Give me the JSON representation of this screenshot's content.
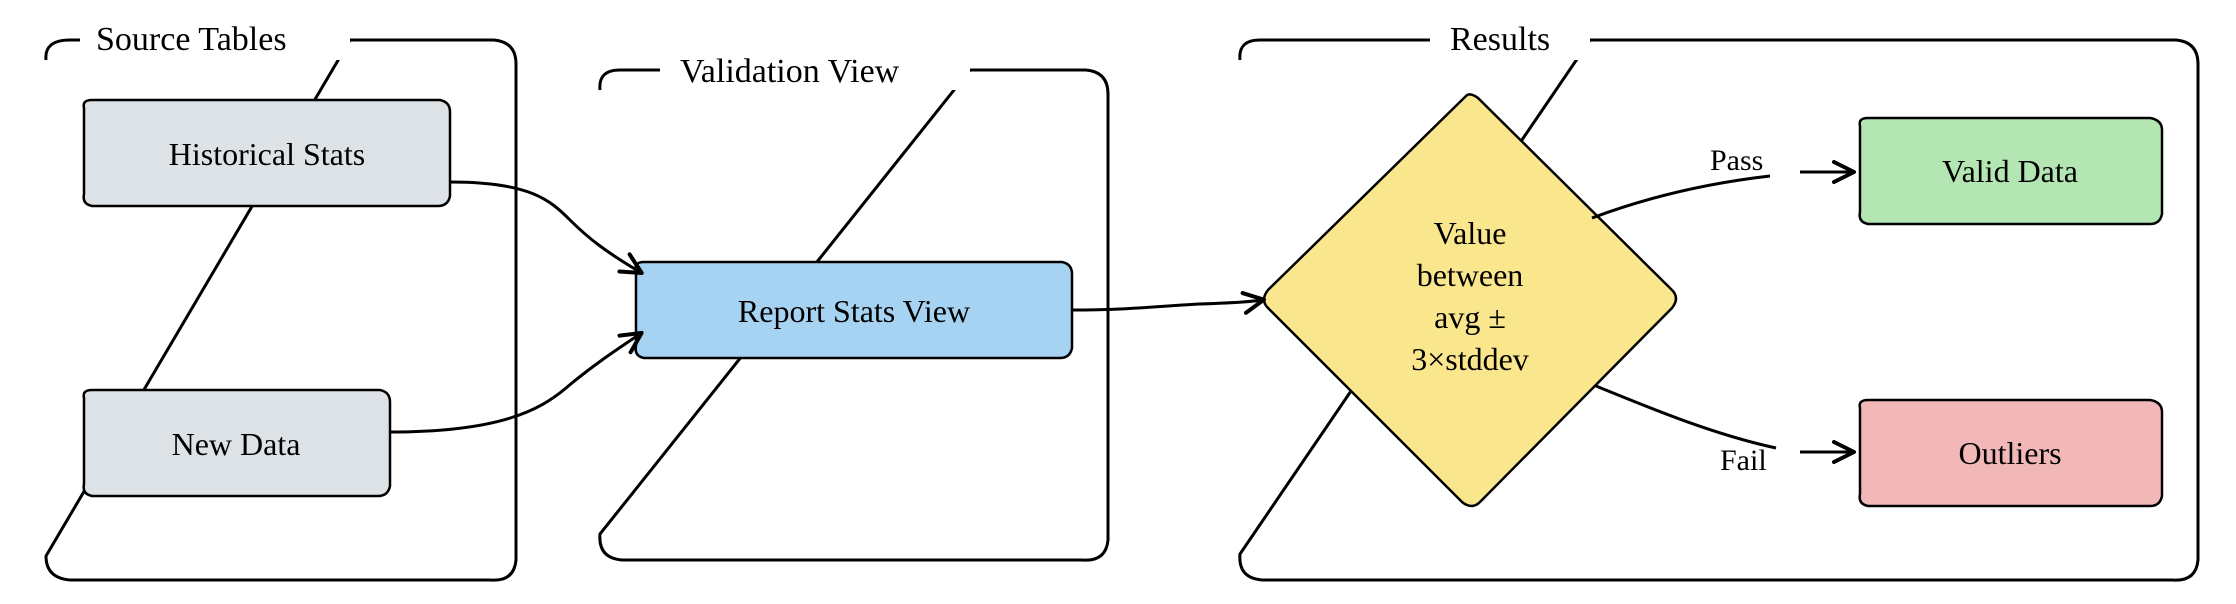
{
  "groups": {
    "source": {
      "label": "Source Tables"
    },
    "validation": {
      "label": "Validation View"
    },
    "results": {
      "label": "Results"
    }
  },
  "nodes": {
    "historical": {
      "label": "Historical Stats"
    },
    "newdata": {
      "label": "New Data"
    },
    "reportstats": {
      "label": "Report Stats View"
    },
    "decision": {
      "line1": "Value",
      "line2": "between",
      "line3": "avg ±",
      "line4": "3×stddev"
    },
    "validdata": {
      "label": "Valid Data"
    },
    "outliers": {
      "label": "Outliers"
    }
  },
  "edges": {
    "pass": {
      "label": "Pass"
    },
    "fail": {
      "label": "Fail"
    }
  },
  "colors": {
    "gray": "#dde2e6",
    "blue": "#a7d3f2",
    "yellow": "#fae68c",
    "green": "#b3e6b3",
    "pink": "#f2b8b8"
  }
}
